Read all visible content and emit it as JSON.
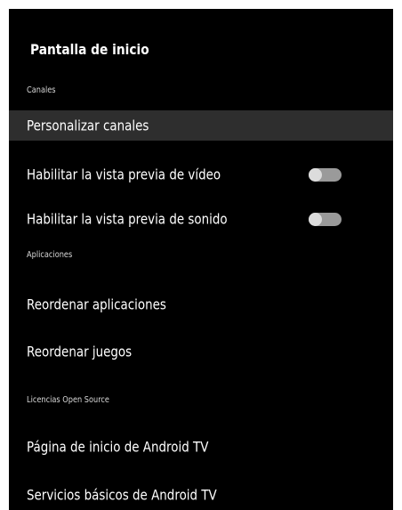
{
  "screen": {
    "title": "Pantalla de inicio"
  },
  "sections": {
    "channels": "Canales",
    "apps": "Aplicaciones",
    "licenses": "Licencias Open Source"
  },
  "items": {
    "customize_channels": "Personalizar canales",
    "video_preview": "Habilitar la vista previa de vídeo",
    "audio_preview": "Habilitar la vista previa de sonido",
    "reorder_apps": "Reordenar aplicaciones",
    "reorder_games": "Reordenar juegos",
    "android_tv_home": "Página de inicio de Android TV",
    "android_tv_core": "Servicios básicos de Android TV"
  },
  "toggles": {
    "video_preview_on": false,
    "audio_preview_on": false
  },
  "colors": {
    "background": "#000000",
    "focused_row": "#2e2e2e",
    "toggle_track": "#9a9a9a",
    "toggle_knob": "#dcdcdc"
  }
}
